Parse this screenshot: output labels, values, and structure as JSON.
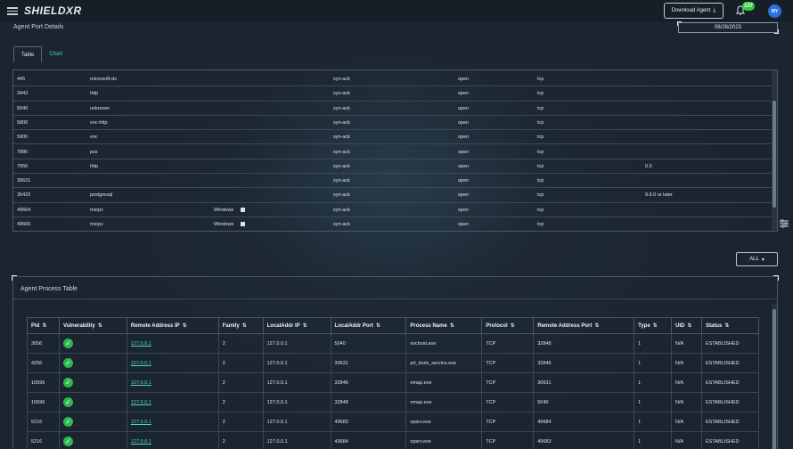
{
  "app": {
    "logo_text": "SHIELDXR"
  },
  "header": {
    "download_label": "Download Agent",
    "notification_count": "137",
    "avatar_initials": "MY"
  },
  "port_section": {
    "title": "Agent Port Details",
    "date": "06/26/2023",
    "tabs": [
      {
        "label": "Table",
        "active": true
      },
      {
        "label": "Chart",
        "active": false
      }
    ],
    "rows": [
      {
        "port": "445",
        "service": "microsoft-ds",
        "os": "",
        "reason": "syn-ack",
        "state": "open",
        "protocol": "tcp",
        "version": ""
      },
      {
        "port": "3443",
        "service": "http",
        "os": "",
        "reason": "syn-ack",
        "state": "open",
        "protocol": "tcp",
        "version": ""
      },
      {
        "port": "5040",
        "service": "unknown",
        "os": "",
        "reason": "syn-ack",
        "state": "open",
        "protocol": "tcp",
        "version": ""
      },
      {
        "port": "5800",
        "service": "vnc-http",
        "os": "",
        "reason": "syn-ack",
        "state": "open",
        "protocol": "tcp",
        "version": ""
      },
      {
        "port": "5900",
        "service": "vnc",
        "os": "",
        "reason": "syn-ack",
        "state": "open",
        "protocol": "tcp",
        "version": ""
      },
      {
        "port": "7880",
        "service": "pss",
        "os": "",
        "reason": "syn-ack",
        "state": "open",
        "protocol": "tcp",
        "version": ""
      },
      {
        "port": "7950",
        "service": "http",
        "os": "",
        "reason": "syn-ack",
        "state": "open",
        "protocol": "tcp",
        "version": "0.6"
      },
      {
        "port": "30631",
        "service": "",
        "os": "",
        "reason": "syn-ack",
        "state": "open",
        "protocol": "tcp",
        "version": ""
      },
      {
        "port": "35432",
        "service": "postgresql",
        "os": "",
        "reason": "syn-ack",
        "state": "open",
        "protocol": "tcp",
        "version": "9.6.0 or later"
      },
      {
        "port": "49664",
        "service": "msrpc",
        "os": "Windows",
        "reason": "syn-ack",
        "state": "open",
        "protocol": "tcp",
        "version": ""
      },
      {
        "port": "49665",
        "service": "msrpc",
        "os": "Windows",
        "reason": "syn-ack",
        "state": "open",
        "protocol": "tcp",
        "version": ""
      }
    ]
  },
  "filter": {
    "all_label": "ALL"
  },
  "process_section": {
    "title": "Agent Process Table",
    "columns": [
      "Pid",
      "Vulnerability",
      "Remote Address IP",
      "Family",
      "LocalAddr IP",
      "LocalAddr Port",
      "Process Name",
      "Protocol",
      "Remote Address Port",
      "Type",
      "UID",
      "Status"
    ],
    "rows": [
      {
        "pid": "3056",
        "remote_ip": "127.0.0.1",
        "family": "2",
        "local_ip": "127.0.0.1",
        "local_port": "5040",
        "process": "svchost.exe",
        "protocol": "TCP",
        "remote_port": "32848",
        "type": "1",
        "uid": "N/A",
        "status": "ESTABLISHED"
      },
      {
        "pid": "4256",
        "remote_ip": "127.0.0.1",
        "family": "2",
        "local_ip": "127.0.0.1",
        "local_port": "30631",
        "process": "prl_tools_service.exe",
        "protocol": "TCP",
        "remote_port": "32846",
        "type": "1",
        "uid": "N/A",
        "status": "ESTABLISHED"
      },
      {
        "pid": "10596",
        "remote_ip": "127.0.0.1",
        "family": "2",
        "local_ip": "127.0.0.1",
        "local_port": "32846",
        "process": "nmap.exe",
        "protocol": "TCP",
        "remote_port": "30631",
        "type": "1",
        "uid": "N/A",
        "status": "ESTABLISHED"
      },
      {
        "pid": "10596",
        "remote_ip": "127.0.0.1",
        "family": "2",
        "local_ip": "127.0.0.1",
        "local_port": "32848",
        "process": "nmap.exe",
        "protocol": "TCP",
        "remote_port": "5040",
        "type": "1",
        "uid": "N/A",
        "status": "ESTABLISHED"
      },
      {
        "pid": "5216",
        "remote_ip": "127.0.0.1",
        "family": "2",
        "local_ip": "127.0.0.1",
        "local_port": "49683",
        "process": "opsrv.exe",
        "protocol": "TCP",
        "remote_port": "49684",
        "type": "1",
        "uid": "N/A",
        "status": "ESTABLISHED"
      },
      {
        "pid": "5216",
        "remote_ip": "127.0.0.1",
        "family": "2",
        "local_ip": "127.0.0.1",
        "local_port": "49684",
        "process": "opsrv.exe",
        "protocol": "TCP",
        "remote_port": "49683",
        "type": "1",
        "uid": "N/A",
        "status": "ESTABLISHED"
      }
    ]
  },
  "colors": {
    "accent": "#4fd6c6",
    "badge": "#2ecc40",
    "avatar": "#2f6ee0",
    "check": "#2fb84a"
  },
  "icons": [
    "menu-icon",
    "download-icon",
    "bell-icon",
    "windows-icon",
    "filter-settings-icon",
    "caret-down-icon",
    "check-circle-icon"
  ]
}
